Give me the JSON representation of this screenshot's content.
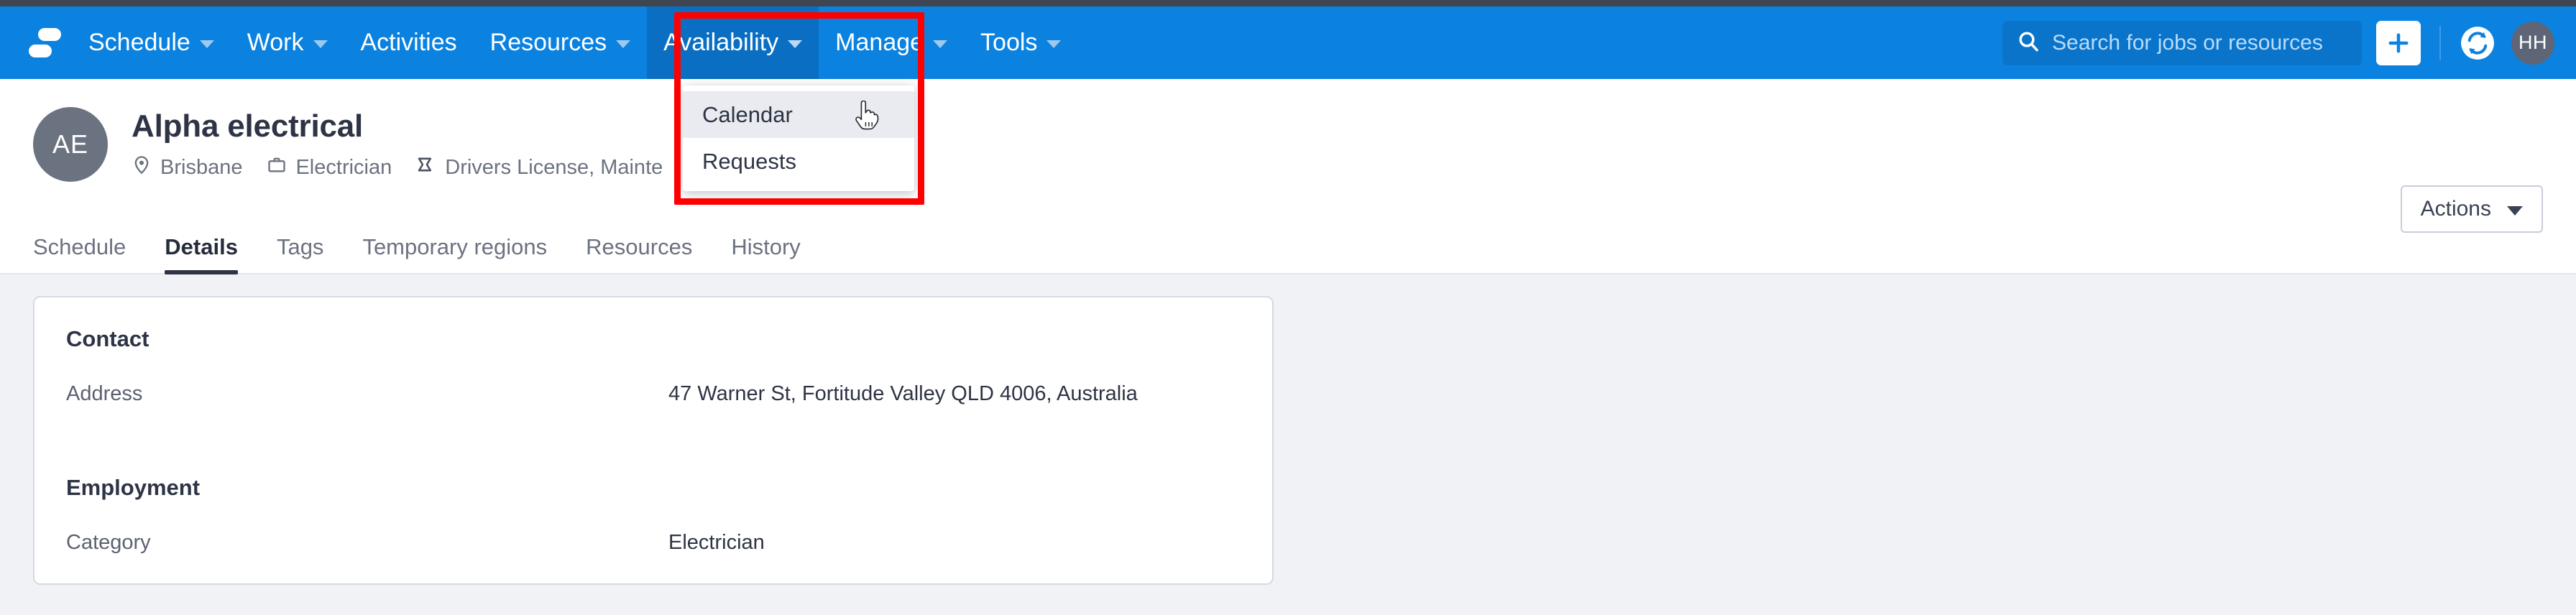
{
  "app": {
    "logo_name": "skedulo-logo",
    "brand_color": "#0b82e0",
    "accent_color": "#0a6fc2",
    "annotation_color": "#ff0000"
  },
  "navbar": {
    "items": [
      {
        "label": "Schedule",
        "has_caret": true,
        "active": false
      },
      {
        "label": "Work",
        "has_caret": true,
        "active": false
      },
      {
        "label": "Activities",
        "has_caret": false,
        "active": false
      },
      {
        "label": "Resources",
        "has_caret": true,
        "active": false
      },
      {
        "label": "Availability",
        "has_caret": true,
        "active": true
      },
      {
        "label": "Manage",
        "has_caret": true,
        "active": false
      },
      {
        "label": "Tools",
        "has_caret": true,
        "active": false
      }
    ],
    "search": {
      "placeholder": "Search for jobs or resources",
      "value": ""
    },
    "create_button_label": "+",
    "sync_icon": "sync-icon",
    "user_avatar_initials": "HH"
  },
  "dropdown": {
    "open_for": "Availability",
    "items": [
      {
        "label": "Calendar",
        "hovered": true
      },
      {
        "label": "Requests",
        "hovered": false
      }
    ]
  },
  "profile": {
    "avatar_initials": "AE",
    "title": "Alpha electrical",
    "meta": [
      {
        "icon": "location-pin-icon",
        "text": "Brisbane"
      },
      {
        "icon": "briefcase-icon",
        "text": "Electrician"
      },
      {
        "icon": "tag-icon",
        "text": "Drivers License, Mainte"
      }
    ],
    "actions_button_label": "Actions"
  },
  "tabs": [
    {
      "label": "Schedule",
      "active": false
    },
    {
      "label": "Details",
      "active": true
    },
    {
      "label": "Tags",
      "active": false
    },
    {
      "label": "Temporary regions",
      "active": false
    },
    {
      "label": "Resources",
      "active": false
    },
    {
      "label": "History",
      "active": false
    }
  ],
  "details": {
    "sections": [
      {
        "title": "Contact",
        "fields": [
          {
            "label": "Address",
            "value": "47 Warner St, Fortitude Valley QLD 4006, Australia"
          }
        ]
      },
      {
        "title": "Employment",
        "fields": [
          {
            "label": "Category",
            "value": "Electrician"
          }
        ]
      }
    ]
  }
}
